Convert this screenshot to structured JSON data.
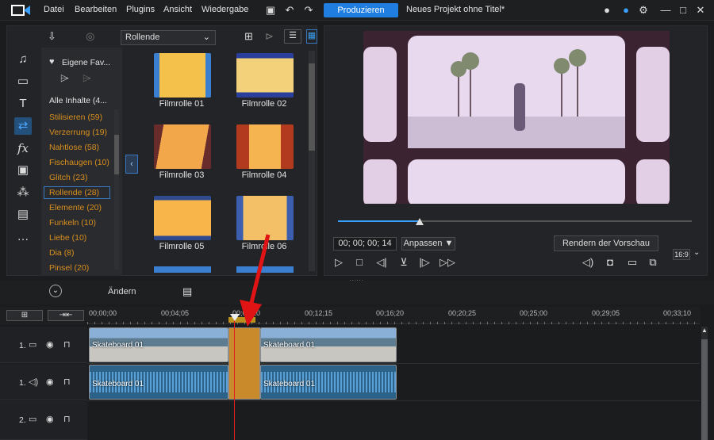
{
  "menu": [
    "Datei",
    "Bearbeiten",
    "Plugins",
    "Ansicht",
    "Wiedergabe"
  ],
  "produce_label": "Produzieren",
  "project_title": "Neues Projekt ohne Titel*",
  "library": {
    "dropdown_value": "Rollende",
    "favorites_label": "Eigene Fav...",
    "all_contents": "Alle Inhalte (4...",
    "categories": [
      {
        "label": "Stilisieren",
        "count": "(59)"
      },
      {
        "label": "Verzerrung",
        "count": "(19)"
      },
      {
        "label": "Nahtlose",
        "count": "(58)"
      },
      {
        "label": "Fischaugen",
        "count": "(10)"
      },
      {
        "label": "Glitch",
        "count": "(23)"
      },
      {
        "label": "Rollende",
        "count": "(28)"
      },
      {
        "label": "Elemente",
        "count": "(20)"
      },
      {
        "label": "Funkeln",
        "count": "(10)"
      },
      {
        "label": "Liebe",
        "count": "(10)"
      },
      {
        "label": "Dia",
        "count": "(8)"
      },
      {
        "label": "Pinsel",
        "count": "(20)"
      }
    ],
    "items": [
      "Filmrolle 01",
      "Filmrolle 02",
      "Filmrolle 03",
      "Filmrolle 04",
      "Filmrolle 05",
      "Filmrolle 06"
    ]
  },
  "preview": {
    "timecode": "00; 00; 00; 14",
    "fit_label": "Anpassen ▼",
    "render_label": "Rendern der Vorschau",
    "aspect_label": "16:9",
    "progress": 0.23
  },
  "toolbar": {
    "edit_label": "Ändern"
  },
  "timeline": {
    "ruler": [
      "00;00;00",
      "00;04;05",
      "00;08;10",
      "00;12;15",
      "00;16;20",
      "00;20;25",
      "00;25;00",
      "00;29;05",
      "00;33;10"
    ],
    "tracks": [
      "1.",
      "1.",
      "2."
    ],
    "clips": {
      "video_a": "Skateboard 01",
      "video_b": "Skateboard 01",
      "audio_a": "Skateboard 01",
      "audio_b": "Skateboard 01"
    }
  },
  "colors": {
    "accent": "#1f7ee0",
    "category": "#d88f1e",
    "playhead": "#e02020"
  }
}
